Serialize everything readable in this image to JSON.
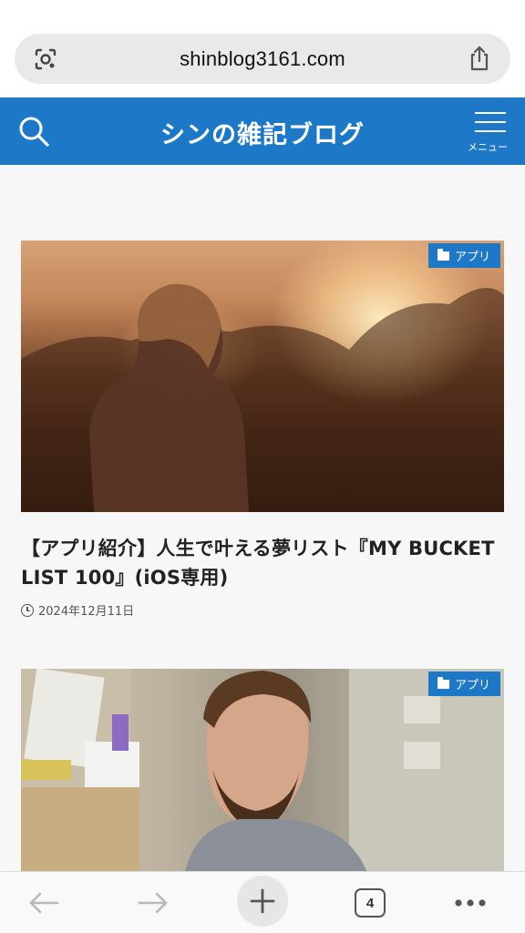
{
  "browser": {
    "url": "shinblog3161.com",
    "tab_count": "4"
  },
  "site": {
    "title": "シンの雑記ブログ",
    "menu_label": "メニュー"
  },
  "posts": [
    {
      "category": "アプリ",
      "title": "【アプリ紹介】人生で叶える夢リスト『MY BUCKET LIST 100』(iOS専用)",
      "date": "2024年12月11日"
    },
    {
      "category": "アプリ"
    }
  ],
  "colors": {
    "header": "#1e78c8",
    "badge": "#1e78c8"
  }
}
